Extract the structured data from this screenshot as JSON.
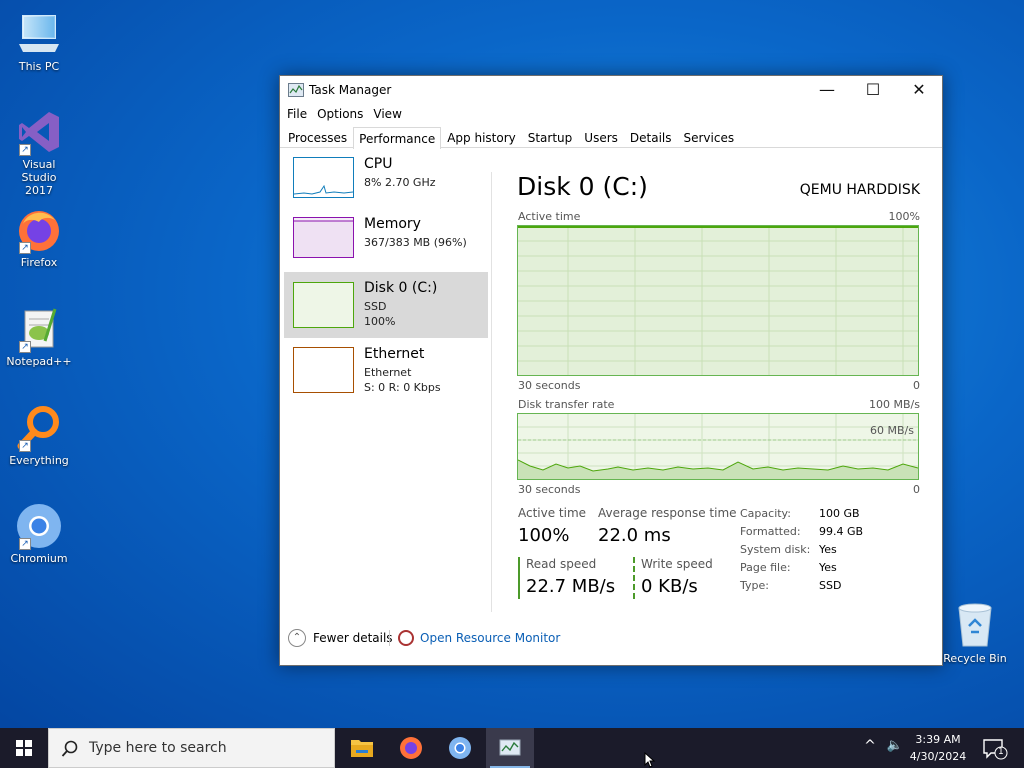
{
  "desktop": {
    "icons": [
      {
        "label": "This PC"
      },
      {
        "label": "Visual Studio 2017"
      },
      {
        "label": "Firefox"
      },
      {
        "label": "Notepad++"
      },
      {
        "label": "Everything"
      },
      {
        "label": "Chromium"
      }
    ],
    "recycle_bin": "Recycle Bin"
  },
  "window": {
    "title": "Task Manager",
    "controls": {
      "minimize": "—",
      "maximize": "☐",
      "close": "✕"
    },
    "menu": [
      "File",
      "Options",
      "View"
    ],
    "tabs": [
      "Processes",
      "Performance",
      "App history",
      "Startup",
      "Users",
      "Details",
      "Services"
    ],
    "active_tab": "Performance"
  },
  "sidebar": {
    "items": [
      {
        "name": "CPU",
        "sub": "8%  2.70 GHz",
        "sub2": "",
        "color": "#117dbb"
      },
      {
        "name": "Memory",
        "sub": "367/383 MB (96%)",
        "sub2": "",
        "color": "#8b12ae"
      },
      {
        "name": "Disk 0 (C:)",
        "sub": "SSD",
        "sub2": "100%",
        "color": "#4da60c"
      },
      {
        "name": "Ethernet",
        "sub": "Ethernet",
        "sub2": "S: 0  R: 0 Kbps",
        "color": "#a74f01"
      }
    ],
    "selected": 2
  },
  "main": {
    "title": "Disk 0 (C:)",
    "model": "QEMU HARDDISK",
    "active_graph": {
      "label": "Active time",
      "max": "100%",
      "time": "30 seconds",
      "min": "0"
    },
    "transfer_graph": {
      "label": "Disk transfer rate",
      "max": "100 MB/s",
      "inner": "60 MB/s",
      "time": "30 seconds",
      "min": "0"
    },
    "stats": {
      "active_time_label": "Active time",
      "active_time": "100%",
      "avg_resp_label": "Average response time",
      "avg_resp": "22.0 ms",
      "read_label": "Read speed",
      "read": "22.7 MB/s",
      "write_label": "Write speed",
      "write": "0 KB/s"
    },
    "properties": [
      {
        "key": "Capacity:",
        "value": "100 GB"
      },
      {
        "key": "Formatted:",
        "value": "99.4 GB"
      },
      {
        "key": "System disk:",
        "value": "Yes"
      },
      {
        "key": "Page file:",
        "value": "Yes"
      },
      {
        "key": "Type:",
        "value": "SSD"
      }
    ]
  },
  "footer": {
    "fewer_details": "Fewer details",
    "open_rm": "Open Resource Monitor"
  },
  "taskbar": {
    "search_placeholder": "Type here to search",
    "time": "3:39 AM",
    "date": "4/30/2024",
    "notif_count": "1"
  },
  "colors": {
    "disk_green": "#4da60c",
    "graph_bg": "#eef6e7",
    "link": "#0b5fb5"
  }
}
